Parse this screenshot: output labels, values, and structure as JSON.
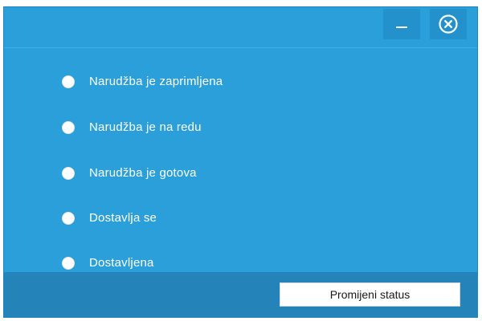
{
  "window": {
    "accent_color": "#2b9fd9",
    "footer_color": "#2483b8"
  },
  "titlebar": {
    "minimize_icon": "minimize-icon",
    "close_icon": "close-circle-icon"
  },
  "status_options": [
    {
      "label": "Narudžba je zaprimljena"
    },
    {
      "label": "Narudžba je na redu"
    },
    {
      "label": "Narudžba je gotova"
    },
    {
      "label": "Dostavlja se"
    },
    {
      "label": "Dostavljena"
    }
  ],
  "footer": {
    "change_status_label": "Promijeni status"
  }
}
